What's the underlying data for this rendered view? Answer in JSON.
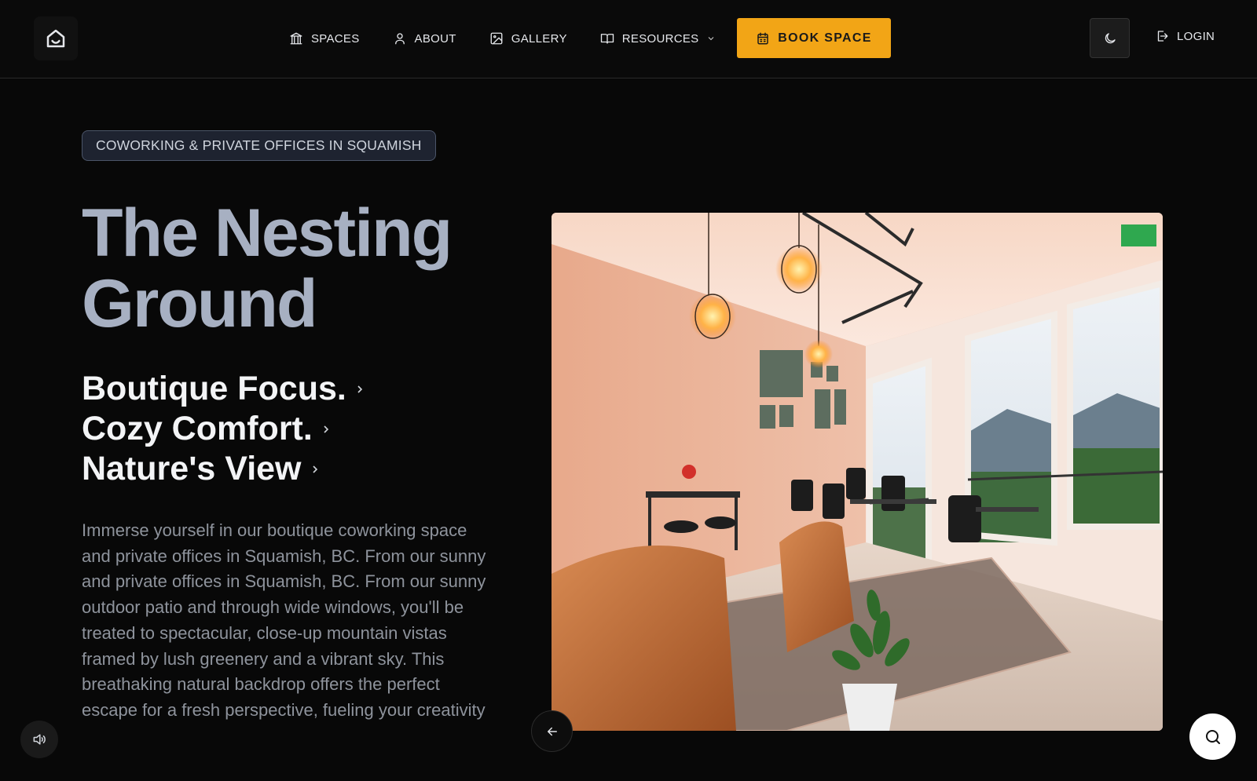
{
  "header": {
    "logo_icon": "home-icon",
    "nav": [
      {
        "label": "SPACES",
        "icon": "building-columns-icon"
      },
      {
        "label": "ABOUT",
        "icon": "user-icon"
      },
      {
        "label": "GALLERY",
        "icon": "image-icon"
      },
      {
        "label": "RESOURCES",
        "icon": "book-icon",
        "dropdown": true
      }
    ],
    "book_label": "BOOK SPACE",
    "theme_icon": "moon-icon",
    "login_label": "LOGIN"
  },
  "hero": {
    "badge": "COWORKING & PRIVATE OFFICES IN SQUAMISH",
    "title_line1": "The Nesting",
    "title_line2": "Ground",
    "features": [
      "Boutique Focus.",
      "Cozy Comfort.",
      "Nature's View"
    ],
    "description": "Immerse yourself in our boutique coworking space and private offices in Squamish, BC. From our sunny and private offices in Squamish, BC. From our sunny outdoor patio and through wide windows, you'll be treated to spectacular, close-up mountain vistas framed by lush greenery and a vibrant sky. This breathaking natural backdrop offers the perfect escape for a fresh perspective, fueling your creativity"
  },
  "colors": {
    "accent": "#f2a516",
    "background": "#080808",
    "title": "#a7b0c2"
  }
}
